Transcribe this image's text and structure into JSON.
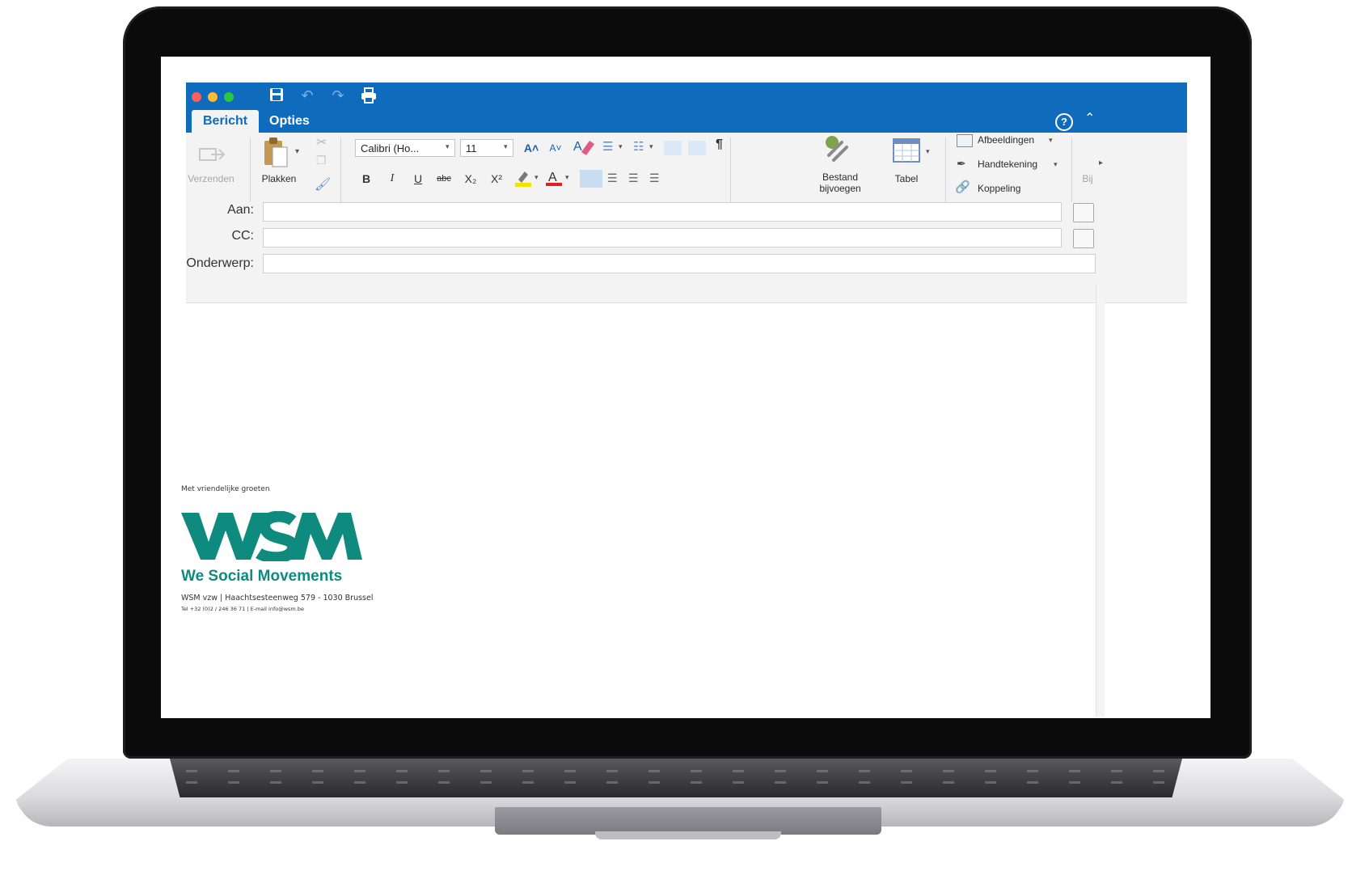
{
  "window": {
    "tabs": [
      {
        "label": "Bericht",
        "active": true
      },
      {
        "label": "Opties",
        "active": false
      }
    ]
  },
  "ribbon": {
    "send_label": "Verzenden",
    "paste_label": "Plakken",
    "font_name": "Calibri (Ho...",
    "font_size": "11",
    "bold_label": "B",
    "italic_label": "I",
    "underline_label": "U",
    "strikethrough_label": "abc",
    "subscript_label": "X₂",
    "superscript_label": "X²",
    "grow_font_label": "A˄",
    "shrink_font_label": "A˅",
    "attach_label_line1": "Bestand",
    "attach_label_line2": "bijvoegen",
    "table_label": "Tabel",
    "pictures_label": "Afbeeldingen",
    "signature_label": "Handtekening",
    "link_label": "Koppeling",
    "overflow_label": "Bij"
  },
  "header": {
    "to_label": "Aan:",
    "to_value": "",
    "cc_label": "CC:",
    "cc_value": "",
    "subject_label": "Onderwerp:",
    "subject_value": ""
  },
  "signature": {
    "greeting": "Met vriendelijke groeten",
    "logo_text": "WSM",
    "company_name": "We Social Movements",
    "address_line": "WSM vzw | Haachtsesteenweg 579 - 1030 Brussel",
    "contact_line": "Tel +32 (0)2 / 246 36 71 | E-mail info@wsm.be"
  },
  "colors": {
    "titlebar": "#0f6cbd",
    "brand_green": "#0f8a7e",
    "close_red": "#ff5f57",
    "minimize_yellow": "#febc2e",
    "zoom_green": "#28c840"
  }
}
